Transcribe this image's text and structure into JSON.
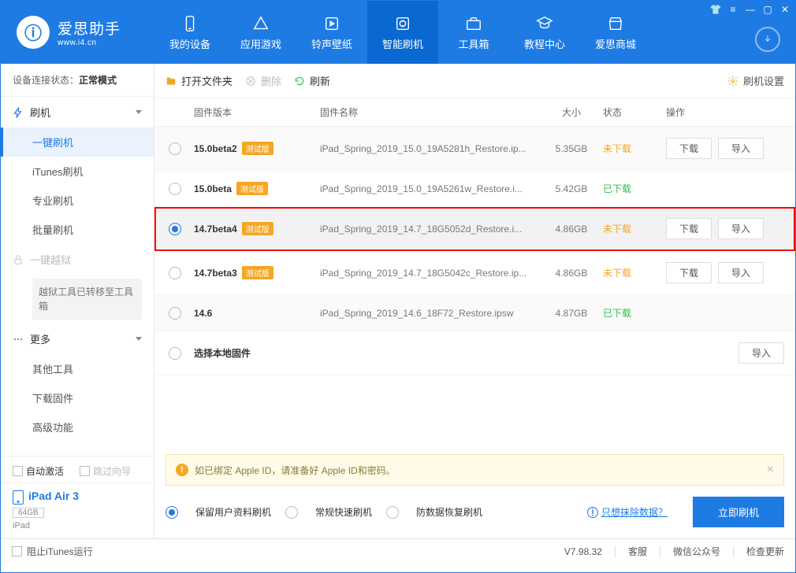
{
  "app": {
    "title": "爱思助手",
    "subtitle": "www.i4.cn"
  },
  "nav": {
    "items": [
      {
        "label": "我的设备"
      },
      {
        "label": "应用游戏"
      },
      {
        "label": "铃声壁纸"
      },
      {
        "label": "智能刷机"
      },
      {
        "label": "工具箱"
      },
      {
        "label": "教程中心"
      },
      {
        "label": "爱思商城"
      }
    ]
  },
  "sidebar": {
    "conn_label": "设备连接状态：",
    "conn_value": "正常模式",
    "flash_group": "刷机",
    "flash_items": [
      "一键刷机",
      "iTunes刷机",
      "专业刷机",
      "批量刷机"
    ],
    "jailbreak": "一键越狱",
    "jailbreak_note": "越狱工具已转移至工具箱",
    "more": "更多",
    "more_items": [
      "其他工具",
      "下载固件",
      "高级功能"
    ],
    "auto_activate": "自动激活",
    "skip_guide": "跳过向导",
    "device_name": "iPad Air 3",
    "device_storage": "64GB",
    "device_type": "iPad"
  },
  "toolbar": {
    "open_folder": "打开文件夹",
    "delete": "删除",
    "refresh": "刷新",
    "settings": "刷机设置"
  },
  "columns": {
    "version": "固件版本",
    "name": "固件名称",
    "size": "大小",
    "status": "状态",
    "ops": "操作"
  },
  "badges": {
    "beta": "测试版"
  },
  "buttons": {
    "download": "下载",
    "import": "导入"
  },
  "status_labels": {
    "not_downloaded": "未下载",
    "downloaded": "已下载"
  },
  "firmware": [
    {
      "version": "15.0beta2",
      "beta": true,
      "name": "iPad_Spring_2019_15.0_19A5281h_Restore.ip...",
      "size": "5.35GB",
      "status": "not_downloaded",
      "selected": false,
      "show_ops": true
    },
    {
      "version": "15.0beta",
      "beta": true,
      "name": "iPad_Spring_2019_15.0_19A5261w_Restore.i...",
      "size": "5.42GB",
      "status": "downloaded",
      "selected": false,
      "show_ops": false
    },
    {
      "version": "14.7beta4",
      "beta": true,
      "name": "iPad_Spring_2019_14.7_18G5052d_Restore.i...",
      "size": "4.86GB",
      "status": "not_downloaded",
      "selected": true,
      "show_ops": true,
      "highlight": true
    },
    {
      "version": "14.7beta3",
      "beta": true,
      "name": "iPad_Spring_2019_14.7_18G5042c_Restore.ip...",
      "size": "4.86GB",
      "status": "not_downloaded",
      "selected": false,
      "show_ops": true
    },
    {
      "version": "14.6",
      "beta": false,
      "name": "iPad_Spring_2019_14.6_18F72_Restore.ipsw",
      "size": "4.87GB",
      "status": "downloaded",
      "selected": false,
      "show_ops": false
    }
  ],
  "local_firmware": "选择本地固件",
  "warning": "如已绑定 Apple ID，请准备好 Apple ID和密码。",
  "flash_options": {
    "keep_data": "保留用户资料刷机",
    "normal": "常规快速刷机",
    "anti_recovery": "防数据恢复刷机",
    "erase_link": "只想抹除数据？",
    "flash_now": "立即刷机"
  },
  "footer": {
    "block_itunes": "阻止iTunes运行",
    "version": "V7.98.32",
    "service": "客服",
    "wechat": "微信公众号",
    "update": "检查更新"
  }
}
